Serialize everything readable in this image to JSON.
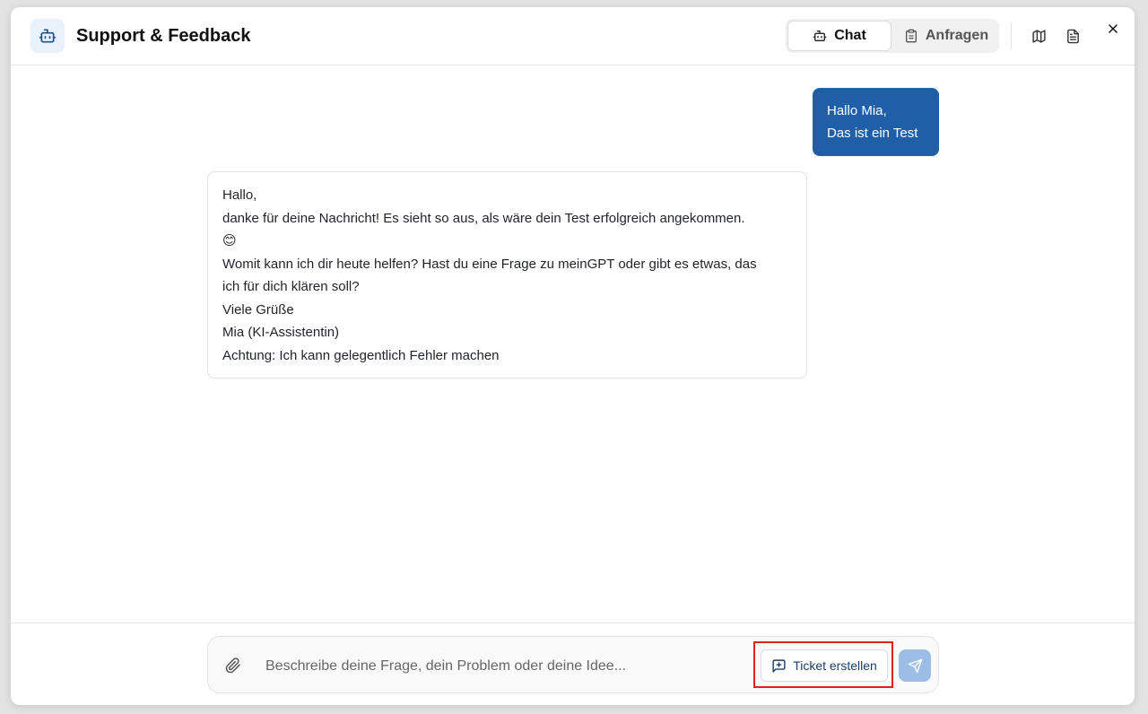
{
  "header": {
    "title": "Support & Feedback",
    "tabs": [
      {
        "label": "Chat",
        "icon": "bot-icon",
        "active": true
      },
      {
        "label": "Anfragen",
        "icon": "clipboard-icon",
        "active": false
      }
    ],
    "icons": [
      "map-icon",
      "document-icon",
      "close-icon"
    ]
  },
  "messages": {
    "user": {
      "lines": [
        "Hallo Mia,",
        "Das ist ein Test"
      ]
    },
    "assistant": {
      "lines": [
        "Hallo,",
        "danke für deine Nachricht! Es sieht so aus, als wäre dein Test erfolgreich angekommen.",
        "😊",
        "Womit kann ich dir heute helfen? Hast du eine Frage zu meinGPT oder gibt es etwas, das",
        "ich für dich klären soll?",
        "Viele Grüße",
        "Mia (KI-Assistentin)",
        "Achtung: Ich kann gelegentlich Fehler machen"
      ]
    }
  },
  "composer": {
    "placeholder": "Beschreibe deine Frage, dein Problem oder deine Idee...",
    "value": "",
    "ticket_label": "Ticket erstellen",
    "icons": [
      "paperclip-icon",
      "message-plus-icon",
      "send-icon"
    ]
  },
  "colors": {
    "accent": "#1f5fa8",
    "send_disabled": "#9cbde6",
    "highlight": "#d9261c",
    "logo_bg": "#e9f1fb"
  }
}
